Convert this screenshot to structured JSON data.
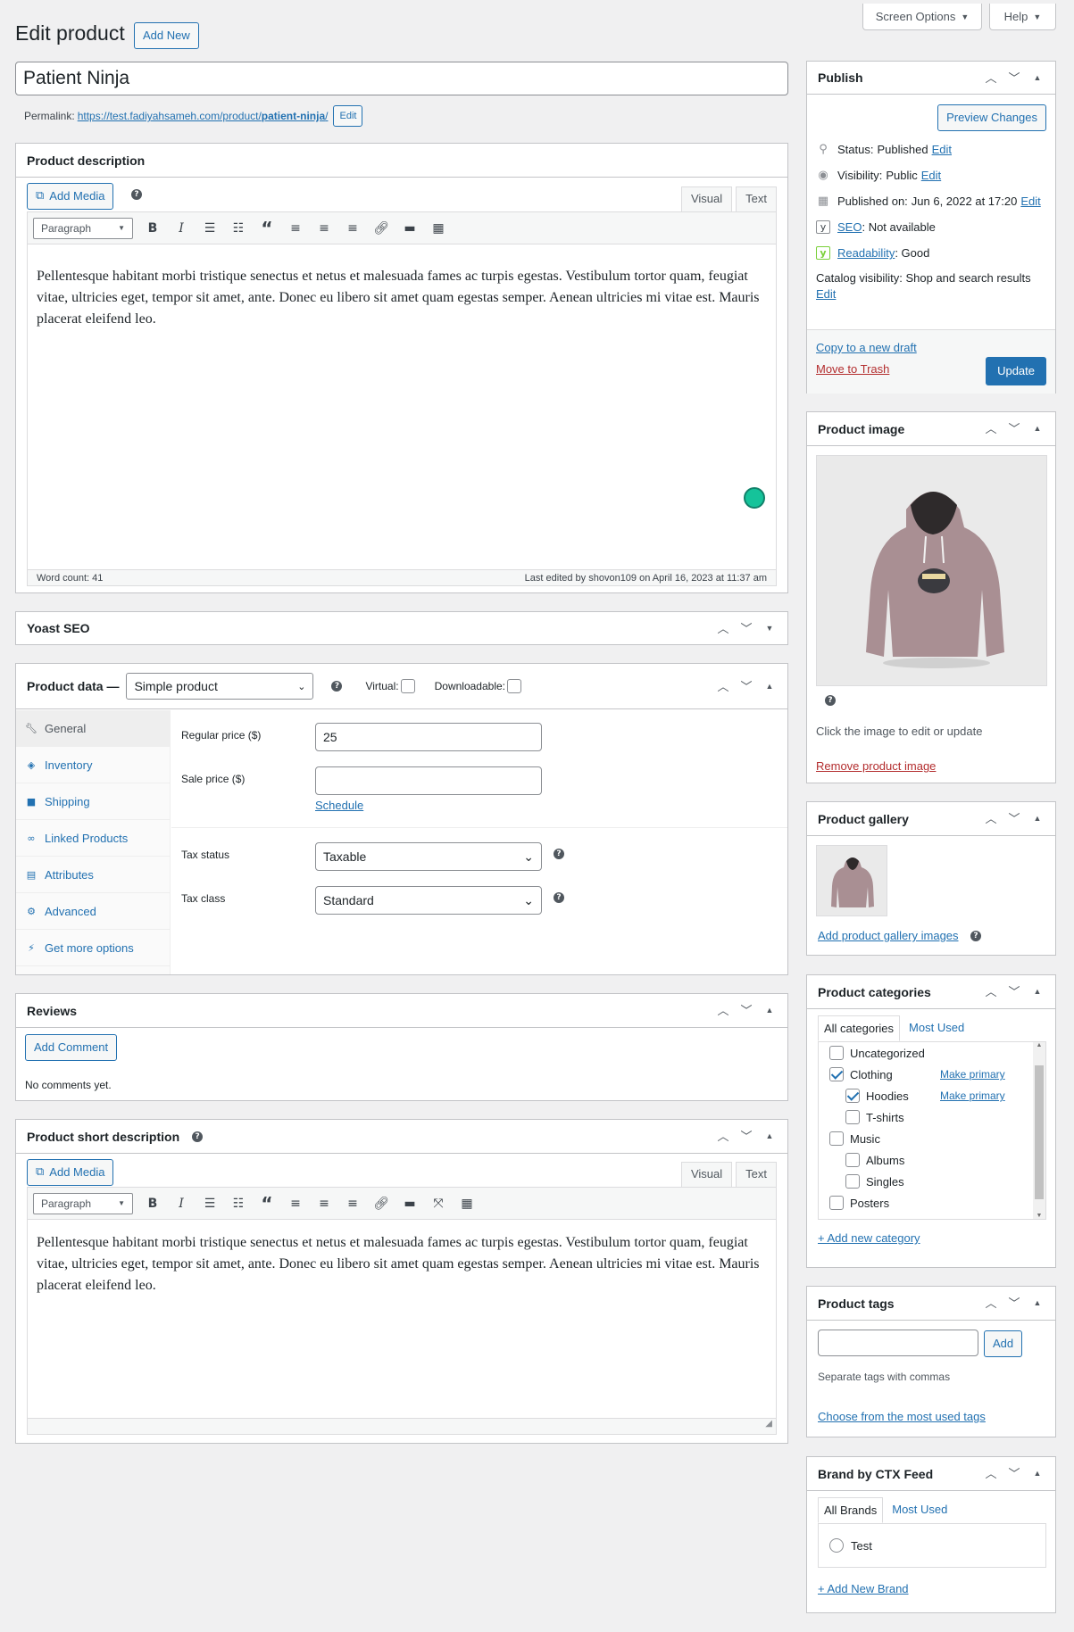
{
  "page": {
    "title": "Edit product",
    "add_new": "Add New",
    "screen_options": "Screen Options",
    "help": "Help"
  },
  "post": {
    "title": "Patient Ninja",
    "permalink_label": "Permalink:",
    "permalink_base": "https://test.fadiyahsameh.com/product/",
    "permalink_slug": "patient-ninja",
    "permalink_end": "/",
    "permalink_edit": "Edit"
  },
  "description": {
    "heading": "Product description",
    "add_media": "Add Media",
    "tab_visual": "Visual",
    "tab_text": "Text",
    "format": "Paragraph",
    "content": "Pellentesque habitant morbi tristique senectus et netus et malesuada fames ac turpis egestas. Vestibulum tortor quam, feugiat vitae, ultricies eget, tempor sit amet, ante. Donec eu libero sit amet quam egestas semper. Aenean ultricies mi vitae est. Mauris placerat eleifend leo.",
    "word_count": "Word count: 41",
    "last_edited": "Last edited by shovon109 on April 16, 2023 at 11:37 am"
  },
  "yoast": {
    "heading": "Yoast SEO"
  },
  "product_data": {
    "heading": "Product data —",
    "type": "Simple product",
    "virtual": "Virtual:",
    "downloadable": "Downloadable:",
    "tabs": [
      {
        "label": "General",
        "icon": "wrench-icon"
      },
      {
        "label": "Inventory",
        "icon": "tag-icon"
      },
      {
        "label": "Shipping",
        "icon": "truck-icon"
      },
      {
        "label": "Linked Products",
        "icon": "link-icon"
      },
      {
        "label": "Attributes",
        "icon": "table-icon"
      },
      {
        "label": "Advanced",
        "icon": "gear-icon"
      },
      {
        "label": "Get more options",
        "icon": "plugin-icon"
      }
    ],
    "regular_price_label": "Regular price ($)",
    "regular_price": "25",
    "sale_price_label": "Sale price ($)",
    "sale_price": "",
    "schedule": "Schedule",
    "tax_status_label": "Tax status",
    "tax_status": "Taxable",
    "tax_class_label": "Tax class",
    "tax_class": "Standard"
  },
  "reviews": {
    "heading": "Reviews",
    "add_comment": "Add Comment",
    "empty": "No comments yet."
  },
  "short_description": {
    "heading": "Product short description",
    "add_media": "Add Media",
    "tab_visual": "Visual",
    "tab_text": "Text",
    "format": "Paragraph",
    "content": "Pellentesque habitant morbi tristique senectus et netus et malesuada fames ac turpis egestas. Vestibulum tortor quam, feugiat vitae, ultricies eget, tempor sit amet, ante. Donec eu libero sit amet quam egestas semper. Aenean ultricies mi vitae est. Mauris placerat eleifend leo."
  },
  "publish": {
    "heading": "Publish",
    "preview": "Preview Changes",
    "status_label": "Status:",
    "status": "Published",
    "visibility_label": "Visibility:",
    "visibility": "Public",
    "published_label": "Published on:",
    "published": "Jun 6, 2022 at 17:20",
    "edit": "Edit",
    "seo_link": "SEO",
    "seo_value": ": Not available",
    "readability_link": "Readability",
    "readability_value": ": Good",
    "catalog_label": "Catalog visibility:",
    "catalog_value": "Shop and search results",
    "copy_draft": "Copy to a new draft",
    "trash": "Move to Trash",
    "update": "Update"
  },
  "product_image": {
    "heading": "Product image",
    "hint": "Click the image to edit or update",
    "remove": "Remove product image"
  },
  "gallery": {
    "heading": "Product gallery",
    "add": "Add product gallery images"
  },
  "categories": {
    "heading": "Product categories",
    "tab_all": "All categories",
    "tab_most": "Most Used",
    "make_primary": "Make primary",
    "items": [
      {
        "label": "Uncategorized",
        "checked": false,
        "level": 0,
        "primary": false
      },
      {
        "label": "Clothing",
        "checked": true,
        "level": 0,
        "primary": true
      },
      {
        "label": "Hoodies",
        "checked": true,
        "level": 1,
        "primary": true
      },
      {
        "label": "T-shirts",
        "checked": false,
        "level": 1,
        "primary": false
      },
      {
        "label": "Music",
        "checked": false,
        "level": 0,
        "primary": false
      },
      {
        "label": "Albums",
        "checked": false,
        "level": 1,
        "primary": false
      },
      {
        "label": "Singles",
        "checked": false,
        "level": 1,
        "primary": false
      },
      {
        "label": "Posters",
        "checked": false,
        "level": 0,
        "primary": false
      }
    ],
    "add_new": "+ Add new category"
  },
  "tags": {
    "heading": "Product tags",
    "add": "Add",
    "hint": "Separate tags with commas",
    "choose": "Choose from the most used tags"
  },
  "brand": {
    "heading": "Brand by CTX Feed",
    "tab_all": "All Brands",
    "tab_most": "Most Used",
    "item": "Test",
    "add_new": "+ Add New Brand"
  },
  "colors": {
    "accent": "#2271b1",
    "danger": "#b32d2e",
    "yoast_green": "#7ad03a",
    "background": "#f0f0f1"
  }
}
